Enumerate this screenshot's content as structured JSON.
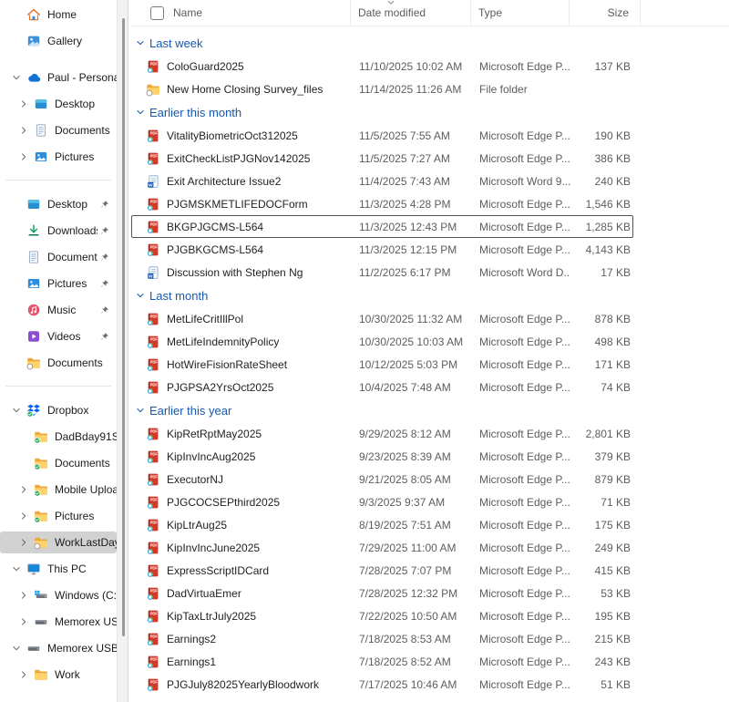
{
  "colors": {
    "accent_blue": "#1757b0",
    "selected_bg": "#d2d2d2",
    "meta_text": "#5d5d5d",
    "pdf_red": "#d03a2b",
    "word_blue": "#185abd",
    "folder_yellow": "#fed36a"
  },
  "sidebar": {
    "items": [
      {
        "label": "Home",
        "icon": "home-icon",
        "chevron": "none",
        "level": 0,
        "pinned": false,
        "selected": false
      },
      {
        "label": "Gallery",
        "icon": "gallery-icon",
        "chevron": "none",
        "level": 0,
        "pinned": false,
        "selected": false
      },
      {
        "spacer": true
      },
      {
        "label": "Paul - Persona",
        "icon": "onedrive-icon",
        "chevron": "down",
        "level": 0,
        "pinned": false,
        "selected": false
      },
      {
        "label": "Desktop",
        "icon": "desktop-icon",
        "chevron": "right",
        "level": 1,
        "pinned": false,
        "selected": false
      },
      {
        "label": "Documents",
        "icon": "document-icon",
        "chevron": "right",
        "level": 1,
        "pinned": false,
        "selected": false
      },
      {
        "label": "Pictures",
        "icon": "picture-icon",
        "chevron": "right",
        "level": 1,
        "pinned": false,
        "selected": false
      },
      {
        "separator": true
      },
      {
        "label": "Desktop",
        "icon": "desktop-icon",
        "chevron": "none",
        "level": 0,
        "pinned": true,
        "selected": false
      },
      {
        "label": "Downloads",
        "icon": "download-icon",
        "chevron": "none",
        "level": 0,
        "pinned": true,
        "selected": false
      },
      {
        "label": "Documents",
        "icon": "document-icon",
        "chevron": "none",
        "level": 0,
        "pinned": true,
        "selected": false
      },
      {
        "label": "Pictures",
        "icon": "picture-icon",
        "chevron": "none",
        "level": 0,
        "pinned": true,
        "selected": false
      },
      {
        "label": "Music",
        "icon": "music-icon",
        "chevron": "none",
        "level": 0,
        "pinned": true,
        "selected": false
      },
      {
        "label": "Videos",
        "icon": "video-icon",
        "chevron": "none",
        "level": 0,
        "pinned": true,
        "selected": false
      },
      {
        "label": "Documents",
        "icon": "folder-link-icon",
        "chevron": "none",
        "level": 0,
        "pinned": false,
        "selected": false
      },
      {
        "separator": true
      },
      {
        "label": "Dropbox",
        "icon": "dropbox-icon",
        "chevron": "down",
        "level": 0,
        "pinned": false,
        "selected": false
      },
      {
        "label": "DadBday91Sa",
        "icon": "folder-sync-icon",
        "chevron": "none",
        "level": 1,
        "pinned": false,
        "selected": false
      },
      {
        "label": "Documents",
        "icon": "folder-sync-icon",
        "chevron": "none",
        "level": 1,
        "pinned": false,
        "selected": false
      },
      {
        "label": "Mobile Uploa",
        "icon": "folder-sync-icon",
        "chevron": "right",
        "level": 1,
        "pinned": false,
        "selected": false
      },
      {
        "label": "Pictures",
        "icon": "folder-sync-icon",
        "chevron": "right",
        "level": 1,
        "pinned": false,
        "selected": false
      },
      {
        "label": "WorkLastDay",
        "icon": "folder-offline-icon",
        "chevron": "right",
        "level": 1,
        "pinned": false,
        "selected": true
      },
      {
        "label": "This PC",
        "icon": "this-pc-icon",
        "chevron": "down",
        "level": 0,
        "pinned": false,
        "selected": false
      },
      {
        "label": "Windows (C:)",
        "icon": "windows-drive-icon",
        "chevron": "right",
        "level": 1,
        "pinned": false,
        "selected": false
      },
      {
        "label": "Memorex US",
        "icon": "usb-drive-icon",
        "chevron": "right",
        "level": 1,
        "pinned": false,
        "selected": false
      },
      {
        "label": "Memorex USB",
        "icon": "usb-drive-icon",
        "chevron": "down",
        "level": 0,
        "pinned": false,
        "selected": false
      },
      {
        "label": "Work",
        "icon": "folder-icon",
        "chevron": "right",
        "level": 1,
        "pinned": false,
        "selected": false
      }
    ]
  },
  "main": {
    "select_all_checked": false,
    "columns": {
      "name": "Name",
      "date": "Date modified",
      "type": "Type",
      "size": "Size",
      "sorted_by": "Date modified",
      "sort_direction": "descending"
    },
    "groups": [
      {
        "label": "Last week",
        "rows": [
          {
            "icon": "pdf-icon",
            "name": "ColoGuard2025",
            "date_modified": "11/10/2025 10:02 AM",
            "type": "Microsoft Edge P...",
            "size": "137 KB"
          },
          {
            "icon": "folder-link-icon",
            "name": "New Home Closing Survey_files",
            "date_modified": "11/14/2025 11:26 AM",
            "type": "File folder",
            "size": ""
          }
        ]
      },
      {
        "label": "Earlier this month",
        "rows": [
          {
            "icon": "pdf-icon",
            "name": "VitalityBiometricOct312025",
            "date_modified": "11/5/2025 7:55 AM",
            "type": "Microsoft Edge P...",
            "size": "190 KB"
          },
          {
            "icon": "pdf-icon",
            "name": "ExitCheckListPJGNov142025",
            "date_modified": "11/5/2025 7:27 AM",
            "type": "Microsoft Edge P...",
            "size": "386 KB"
          },
          {
            "icon": "word-icon",
            "name": "Exit Architecture Issue2",
            "date_modified": "11/4/2025 7:43 AM",
            "type": "Microsoft Word 9...",
            "size": "240 KB"
          },
          {
            "icon": "pdf-icon",
            "name": "PJGMSKMETLIFEDOCForm",
            "date_modified": "11/3/2025 4:28 PM",
            "type": "Microsoft Edge P...",
            "size": "1,546 KB"
          },
          {
            "icon": "pdf-icon",
            "name": "BKGPJGCMS-L564",
            "date_modified": "11/3/2025 12:43 PM",
            "type": "Microsoft Edge P...",
            "size": "1,285 KB",
            "focused": true
          },
          {
            "icon": "pdf-icon",
            "name": "PJGBKGCMS-L564",
            "date_modified": "11/3/2025 12:15 PM",
            "type": "Microsoft Edge P...",
            "size": "4,143 KB"
          },
          {
            "icon": "word-icon",
            "name": "Discussion with Stephen Ng",
            "date_modified": "11/2/2025 6:17 PM",
            "type": "Microsoft Word D...",
            "size": "17 KB"
          }
        ]
      },
      {
        "label": "Last month",
        "rows": [
          {
            "icon": "pdf-icon",
            "name": "MetLifeCritIllPol",
            "date_modified": "10/30/2025 11:32 AM",
            "type": "Microsoft Edge P...",
            "size": "878 KB"
          },
          {
            "icon": "pdf-icon",
            "name": "MetLifeIndemnityPolicy",
            "date_modified": "10/30/2025 10:03 AM",
            "type": "Microsoft Edge P...",
            "size": "498 KB"
          },
          {
            "icon": "pdf-icon",
            "name": "HotWireFisionRateSheet",
            "date_modified": "10/12/2025 5:03 PM",
            "type": "Microsoft Edge P...",
            "size": "171 KB"
          },
          {
            "icon": "pdf-icon",
            "name": "PJGPSA2YrsOct2025",
            "date_modified": "10/4/2025 7:48 AM",
            "type": "Microsoft Edge P...",
            "size": "74 KB"
          }
        ]
      },
      {
        "label": "Earlier this year",
        "rows": [
          {
            "icon": "pdf-icon",
            "name": "KipRetRptMay2025",
            "date_modified": "9/29/2025 8:12 AM",
            "type": "Microsoft Edge P...",
            "size": "2,801 KB"
          },
          {
            "icon": "pdf-icon",
            "name": "KipInvIncAug2025",
            "date_modified": "9/23/2025 8:39 AM",
            "type": "Microsoft Edge P...",
            "size": "379 KB"
          },
          {
            "icon": "pdf-icon",
            "name": "ExecutorNJ",
            "date_modified": "9/21/2025 8:05 AM",
            "type": "Microsoft Edge P...",
            "size": "879 KB"
          },
          {
            "icon": "pdf-icon",
            "name": "PJGCOCSEPthird2025",
            "date_modified": "9/3/2025 9:37 AM",
            "type": "Microsoft Edge P...",
            "size": "71 KB"
          },
          {
            "icon": "pdf-icon",
            "name": "KipLtrAug25",
            "date_modified": "8/19/2025 7:51 AM",
            "type": "Microsoft Edge P...",
            "size": "175 KB"
          },
          {
            "icon": "pdf-icon",
            "name": "KipInvIncJune2025",
            "date_modified": "7/29/2025 11:00 AM",
            "type": "Microsoft Edge P...",
            "size": "249 KB"
          },
          {
            "icon": "pdf-icon",
            "name": "ExpressScriptIDCard",
            "date_modified": "7/28/2025 7:07 PM",
            "type": "Microsoft Edge P...",
            "size": "415 KB"
          },
          {
            "icon": "pdf-icon",
            "name": "DadVirtuaEmer",
            "date_modified": "7/28/2025 12:32 PM",
            "type": "Microsoft Edge P...",
            "size": "53 KB"
          },
          {
            "icon": "pdf-icon",
            "name": "KipTaxLtrJuly2025",
            "date_modified": "7/22/2025 10:50 AM",
            "type": "Microsoft Edge P...",
            "size": "195 KB"
          },
          {
            "icon": "pdf-icon",
            "name": "Earnings2",
            "date_modified": "7/18/2025 8:53 AM",
            "type": "Microsoft Edge P...",
            "size": "215 KB"
          },
          {
            "icon": "pdf-icon",
            "name": "Earnings1",
            "date_modified": "7/18/2025 8:52 AM",
            "type": "Microsoft Edge P...",
            "size": "243 KB"
          },
          {
            "icon": "pdf-icon",
            "name": "PJGJuly82025YearlyBloodwork",
            "date_modified": "7/17/2025 10:46 AM",
            "type": "Microsoft Edge P...",
            "size": "51 KB"
          }
        ]
      }
    ]
  }
}
